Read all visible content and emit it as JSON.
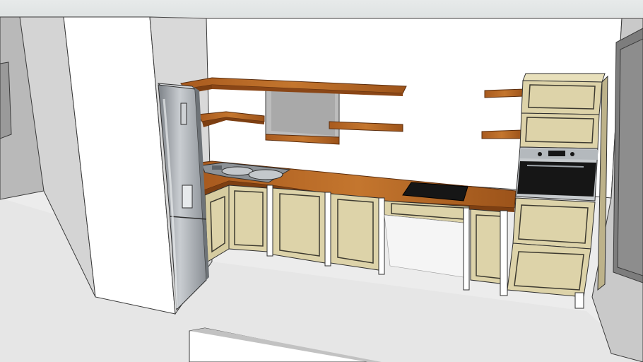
{
  "scene": {
    "subject": "kitchen-3d-model",
    "palette": {
      "floor": "#e3e3e3",
      "wall": "#ffffff",
      "wall_shade": "#cfcfcf",
      "top_bar": "#e9ecec",
      "wood_top": "#b5631f",
      "wood_edge": "#7d3f12",
      "cabinet": "#ddd3a9",
      "cabinet_dark": "#bdb28a",
      "cabinet_line": "#3d3a30",
      "oven_black": "#161616",
      "steel": "#9aa0a6",
      "steel_dark": "#5e6368",
      "outline": "#2f2f2f"
    }
  }
}
